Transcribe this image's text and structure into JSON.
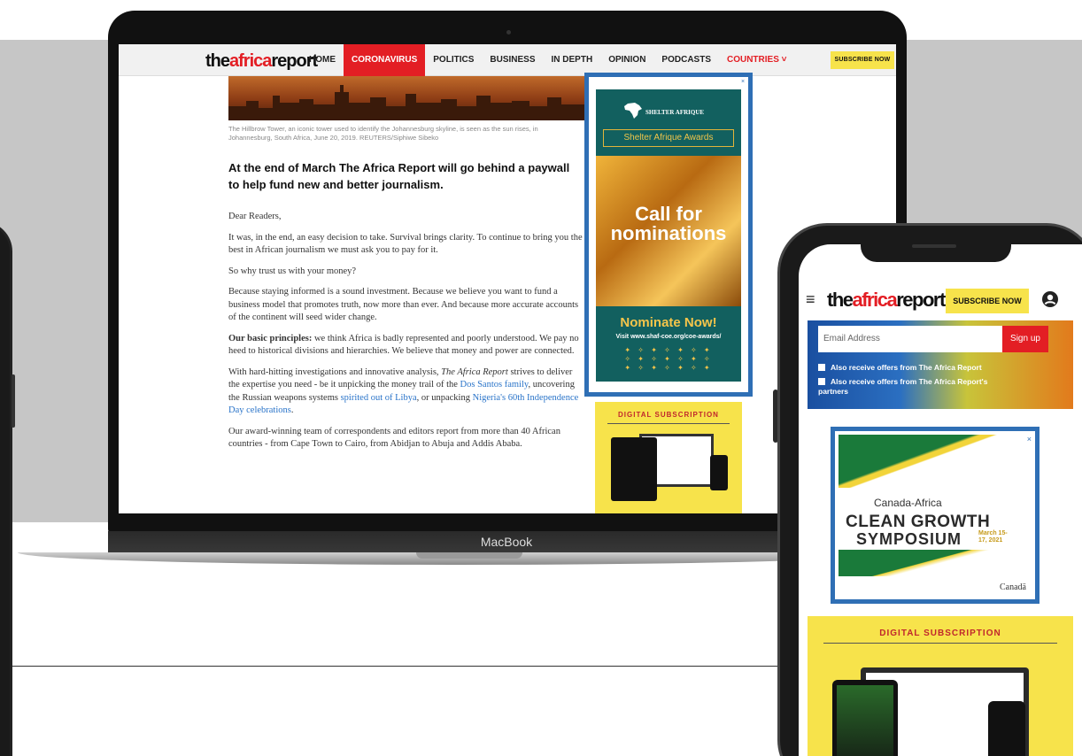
{
  "laptop": {
    "device_label": "MacBook",
    "nav": {
      "brand_pre": "the",
      "brand_mid": "africa",
      "brand_post": "report",
      "items": [
        {
          "label": "HOME",
          "active": false
        },
        {
          "label": "CORONAVIRUS",
          "active": true
        },
        {
          "label": "POLITICS",
          "active": false
        },
        {
          "label": "BUSINESS",
          "active": false
        },
        {
          "label": "IN DEPTH",
          "active": false
        },
        {
          "label": "OPINION",
          "active": false
        },
        {
          "label": "PODCASTS",
          "active": false
        },
        {
          "label": "COUNTRIES ˅",
          "active": false
        }
      ],
      "subscribe": "SUBSCRIBE NOW"
    },
    "caption": "The Hillbrow Tower, an iconic tower used to identify the Johannesburg skyline, is seen as the sun rises, in Johannesburg, South Africa, June 20, 2019. REUTERS/Siphiwe Sibeko",
    "headline": "At the end of March The Africa Report will go behind a paywall to help fund new and better journalism.",
    "article": {
      "greeting": "Dear Readers,",
      "p1": "It was, in the end, an easy decision to take. Survival brings clarity. To continue to bring you the best in African journalism we must ask you to pay for it.",
      "p2": "So why trust us with your money?",
      "p3": "Because staying informed is a sound investment. Because we believe you want to fund a business model that promotes truth, now more than ever. And because more accurate accounts of the continent will seed wider change.",
      "p4_bold": "Our basic principles:",
      "p4_rest": " we think Africa is badly represented and poorly understood. We pay no heed to historical divisions and hierarchies. We believe that money and power are connected.",
      "p5_a": "With hard-hitting investigations and innovative analysis, ",
      "p5_italic": "The Africa Report",
      "p5_b": " strives to deliver the expertise you need - be it unpicking the money trail of the ",
      "p5_link1": "Dos Santos family",
      "p5_c": ", uncovering the Russian weapons systems ",
      "p5_link2": "spirited out of Libya",
      "p5_d": ", or unpacking ",
      "p5_link3": "Nigeria's 60th Independence Day celebrations",
      "p5_e": ".",
      "p6": "Our award-winning team of correspondents and editors report from more than 40 African countries - from Cape Town to Cairo, from Abidjan to Abuja and Addis Ababa."
    },
    "ad": {
      "logo_text": "SHELTER AFRIQUE",
      "award": "Shelter Afrique Awards",
      "call": "Call for nominations",
      "nominate": "Nominate Now!",
      "url": "Visit www.shaf-coe.org/coe-awards/",
      "close": "×"
    },
    "digital_subscription": "DIGITAL SUBSCRIPTION"
  },
  "phone": {
    "brand_pre": "the",
    "brand_mid": "africa",
    "brand_post": "report",
    "subscribe": "SUBSCRIBE NOW",
    "email_placeholder": "Email Address",
    "signup": "Sign up",
    "check1": "Also receive offers from The Africa Report",
    "check2": "Also receive offers from The Africa Report's partners",
    "ad": {
      "line1": "Canada-Africa",
      "line2": "CLEAN GROWTH",
      "line3": "SYMPOSIUM",
      "date": "March 15-17, 2021",
      "logo": "Canadä",
      "close": "×"
    },
    "digital_subscription": "DIGITAL SUBSCRIPTION"
  },
  "colors": {
    "brand_red": "#e31e24",
    "subscribe_yellow": "#f7e34b",
    "ad_border_blue": "#2f6fb5",
    "link_blue": "#2a74c9"
  },
  "icons": [
    "menu-icon",
    "user-icon",
    "close-icon"
  ]
}
